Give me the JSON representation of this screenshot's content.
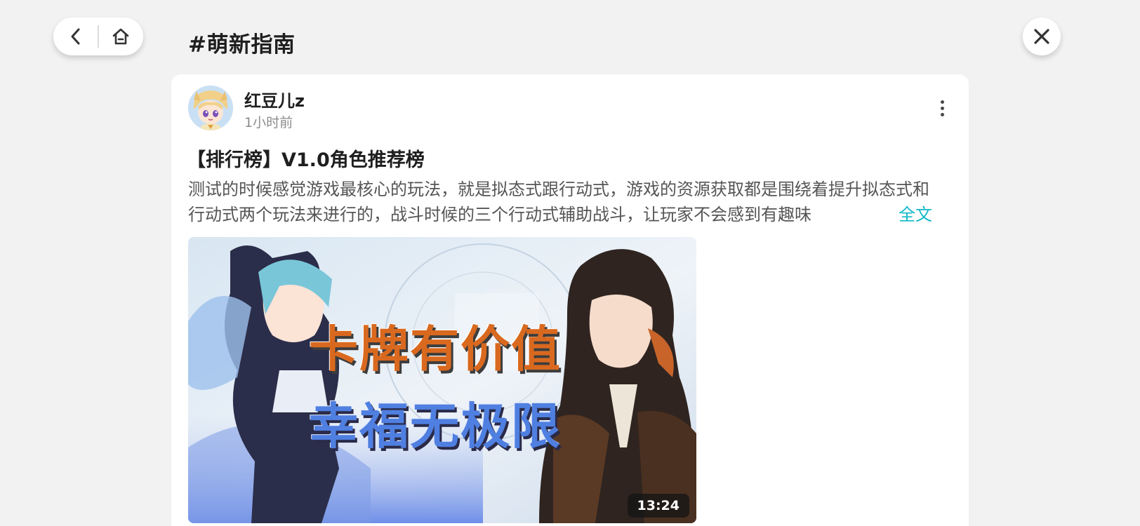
{
  "header": {
    "topic": "#萌新指南"
  },
  "nav": {
    "back_icon": "chevron-left-icon",
    "home_icon": "home-icon",
    "close_icon": "close-icon"
  },
  "post": {
    "author": {
      "name": "红豆儿z",
      "time": "1小时前"
    },
    "title": "【排行榜】V1.0角色推荐榜",
    "excerpt": "测试的时候感觉游戏最核心的玩法，就是拟态式跟行动式，游戏的资源获取都是围绕着提升拟态式和行动式两个玩法来进行的，战斗时候的三个行动式辅助战斗，让玩家不会感到有趣味",
    "fulltext_label": "全文",
    "video": {
      "overlay_line1": "卡牌有价值",
      "overlay_line2": "幸福无极限",
      "duration": "13:24"
    }
  },
  "colors": {
    "background": "#f2f2f2",
    "card": "#ffffff",
    "accent_link": "#13b8c8",
    "overlay_orange": "#d9691f",
    "overlay_blue": "#4f7fe0"
  }
}
